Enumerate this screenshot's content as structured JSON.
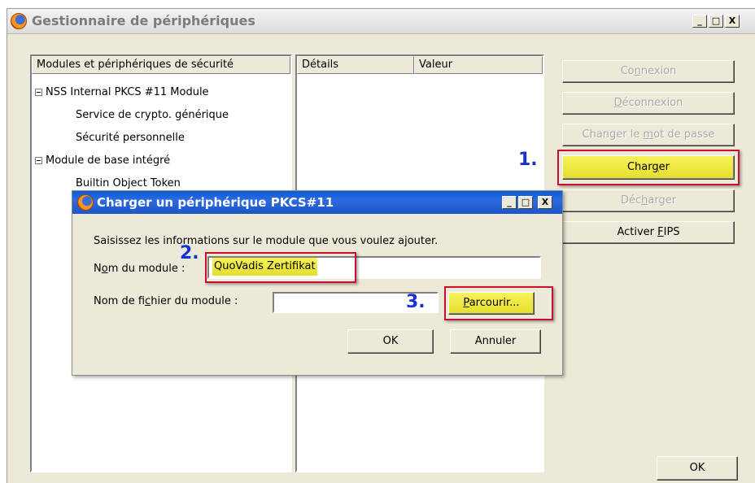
{
  "window": {
    "title": "Gestionnaire de périphériques",
    "controls": {
      "minimize": "_",
      "maximize": "□",
      "close": "X"
    }
  },
  "modules_panel": {
    "header": "Modules et périphériques de sécurité",
    "items": [
      {
        "label": "NSS Internal PKCS #11 Module",
        "expanded": true
      },
      {
        "label": "Service de crypto. générique"
      },
      {
        "label": "Sécurité personnelle"
      },
      {
        "label": "Module de base intégré",
        "expanded": true
      },
      {
        "label": "Builtin Object Token"
      }
    ]
  },
  "details_panel": {
    "col_details": "Détails",
    "col_value": "Valeur"
  },
  "buttons": {
    "connexion": {
      "pre": "Co",
      "u": "n",
      "post": "nexion"
    },
    "deconnexion": {
      "pre": "",
      "u": "D",
      "post": "éconnexion"
    },
    "changer_mdp": {
      "pre": "Changer le ",
      "u": "m",
      "post": "ot de passe"
    },
    "charger": {
      "pre": "Char",
      "u": "g",
      "post": "er"
    },
    "decharger": {
      "pre": "Déc",
      "u": "h",
      "post": "arger"
    },
    "activer_fips": {
      "pre": "Activer ",
      "u": "F",
      "post": "IPS"
    },
    "ok": "OK"
  },
  "annotations": {
    "step1": "1.",
    "step2": "2.",
    "step3": "3."
  },
  "dialog": {
    "title": "Charger un périphérique PKCS#11",
    "instruction": "Saisissez les informations sur le module que vous voulez ajouter.",
    "module_name_label": {
      "pre": "N",
      "u": "o",
      "post": "m du module :"
    },
    "module_name_value": "QuoVadis Zertifikat",
    "module_file_label": {
      "pre": "Nom de fi",
      "u": "c",
      "post": "hier du module :"
    },
    "module_file_value": "",
    "browse": {
      "pre": "",
      "u": "P",
      "post": "arcourir..."
    },
    "ok": "OK",
    "cancel": "Annuler"
  },
  "colors": {
    "highlight": "#f6f25a",
    "annotation_box": "#c8102e",
    "annotation_number": "#1631d6",
    "dialog_title": "#1c55c8"
  }
}
